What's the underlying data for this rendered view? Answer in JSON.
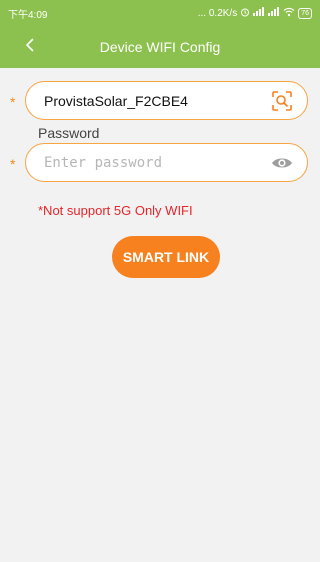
{
  "status_bar": {
    "time": "下午4:09",
    "network_speed": "... 0.2K/s",
    "battery_level": "76"
  },
  "header": {
    "title": "Device WIFI Config",
    "back_icon": "chevron-left-icon"
  },
  "form": {
    "ssid_field": {
      "required_mark": "*",
      "value": "ProvistaSolar_F2CBE4",
      "trailing_icon": "scan-icon"
    },
    "password_label": "Password",
    "password_field": {
      "required_mark": "*",
      "value": "",
      "placeholder": "Enter password",
      "trailing_icon": "eye-icon"
    },
    "warning_text": "*Not support 5G Only WIFI",
    "smart_link_label": "SMART LINK"
  },
  "colors": {
    "header_green": "#8dc14f",
    "accent_orange": "#f7801f",
    "warning_red": "#e5262a",
    "background": "#f2f2f2"
  }
}
